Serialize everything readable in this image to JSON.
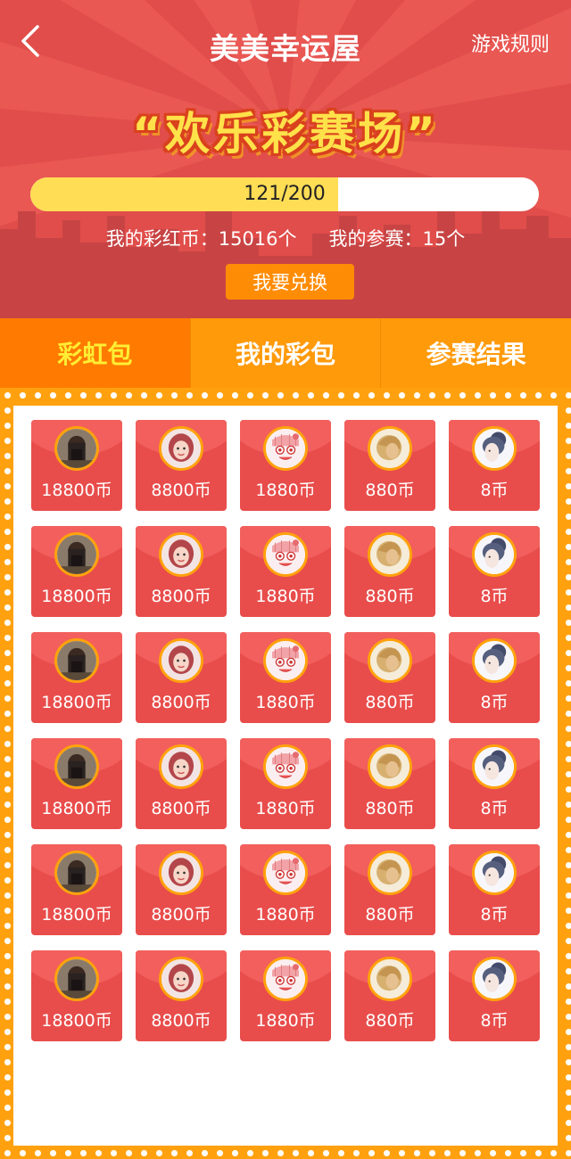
{
  "header": {
    "title": "美美幸运屋",
    "rules_label": "游戏规则",
    "banner": "“欢乐彩赛场”",
    "progress": {
      "text": "121/200",
      "current": 121,
      "total": 200
    },
    "coins_label": "我的彩红币：15016个",
    "entries_label": "我的参赛：15个",
    "exchange_label": "我要兑换"
  },
  "tabs": [
    {
      "label": "彩虹包",
      "active": true
    },
    {
      "label": "我的彩包",
      "active": false
    },
    {
      "label": "参赛结果",
      "active": false
    }
  ],
  "packets": [
    {
      "amount": "18800币",
      "avatar": "avatar-man-dark"
    },
    {
      "amount": "8800币",
      "avatar": "avatar-woman-redhair"
    },
    {
      "amount": "1880币",
      "avatar": "avatar-cartoon"
    },
    {
      "amount": "880币",
      "avatar": "avatar-blond"
    },
    {
      "amount": "8币",
      "avatar": "avatar-woman-bun"
    },
    {
      "amount": "18800币",
      "avatar": "avatar-man-dark"
    },
    {
      "amount": "8800币",
      "avatar": "avatar-woman-redhair"
    },
    {
      "amount": "1880币",
      "avatar": "avatar-cartoon"
    },
    {
      "amount": "880币",
      "avatar": "avatar-blond"
    },
    {
      "amount": "8币",
      "avatar": "avatar-woman-bun"
    },
    {
      "amount": "18800币",
      "avatar": "avatar-man-dark"
    },
    {
      "amount": "8800币",
      "avatar": "avatar-woman-redhair"
    },
    {
      "amount": "1880币",
      "avatar": "avatar-cartoon"
    },
    {
      "amount": "880币",
      "avatar": "avatar-blond"
    },
    {
      "amount": "8币",
      "avatar": "avatar-woman-bun"
    },
    {
      "amount": "18800币",
      "avatar": "avatar-man-dark"
    },
    {
      "amount": "8800币",
      "avatar": "avatar-woman-redhair"
    },
    {
      "amount": "1880币",
      "avatar": "avatar-cartoon"
    },
    {
      "amount": "880币",
      "avatar": "avatar-blond"
    },
    {
      "amount": "8币",
      "avatar": "avatar-woman-bun"
    },
    {
      "amount": "18800币",
      "avatar": "avatar-man-dark"
    },
    {
      "amount": "8800币",
      "avatar": "avatar-woman-redhair"
    },
    {
      "amount": "1880币",
      "avatar": "avatar-cartoon"
    },
    {
      "amount": "880币",
      "avatar": "avatar-blond"
    },
    {
      "amount": "8币",
      "avatar": "avatar-woman-bun"
    },
    {
      "amount": "18800币",
      "avatar": "avatar-man-dark"
    },
    {
      "amount": "8800币",
      "avatar": "avatar-woman-redhair"
    },
    {
      "amount": "1880币",
      "avatar": "avatar-cartoon"
    },
    {
      "amount": "880币",
      "avatar": "avatar-blond"
    },
    {
      "amount": "8币",
      "avatar": "avatar-woman-bun"
    }
  ],
  "colors": {
    "header_red": "#e04d4a",
    "tab_orange": "#ff9a0a",
    "tab_active": "#ff7a00",
    "active_tab_text": "#ffee33",
    "packet_red": "#e84d4b",
    "progress_yellow": "#ffdd55",
    "button_orange": "#ff8c05"
  }
}
